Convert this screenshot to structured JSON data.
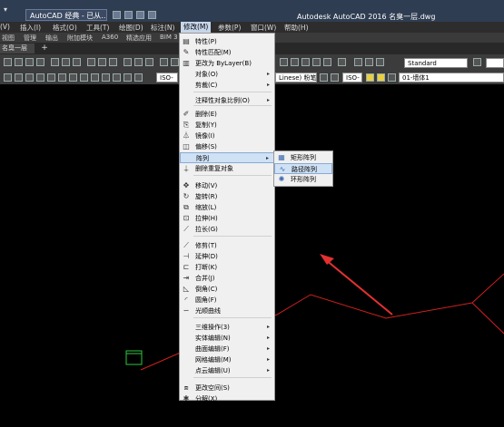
{
  "title_bar": {
    "left_glyph": "▾ ",
    "workspace": "AutoCAD 经典 - 已从...",
    "title": "Autodesk AutoCAD 2016    名臭一层.dwg"
  },
  "menu_bar": {
    "items": [
      "(V)",
      "插入(I)",
      "格式(O)",
      "工具(T)",
      "绘图(D)",
      "标注(N)",
      "修改(M)",
      "参数(P)",
      "窗口(W)",
      "帮助(H)"
    ]
  },
  "ribbon_tabs": [
    "视图",
    "管理",
    "输出",
    "附加模块",
    "A360",
    "精选应用",
    "BIM 3"
  ],
  "file_tab": {
    "label": "名臭一层",
    "plus": "+"
  },
  "toolbar": {
    "text_style": "Standard",
    "layer": "01-墙体1",
    "iso_left": "ISO-",
    "iso_right": "ISO-",
    "linetype": "Linese) 粉笔"
  },
  "modify_menu": {
    "items": [
      {
        "label": "特性(P)",
        "icon": "properties-icon",
        "glyph": "▤",
        "arrow": ""
      },
      {
        "label": "特性匹配(M)",
        "icon": "match-properties-icon",
        "glyph": "✎",
        "arrow": ""
      },
      {
        "label": "更改为 ByLayer(B)",
        "icon": "bylayer-icon",
        "glyph": "▥",
        "arrow": ""
      },
      {
        "label": "对象(O)",
        "icon": "",
        "glyph": "",
        "arrow": "▸"
      },
      {
        "label": "剪裁(C)",
        "icon": "",
        "glyph": "",
        "arrow": "▸"
      },
      {
        "label": "注释性对象比例(O)",
        "icon": "",
        "glyph": "",
        "arrow": "▸"
      },
      {
        "label": "删除(E)",
        "icon": "erase-icon",
        "glyph": "✐",
        "arrow": ""
      },
      {
        "label": "复制(Y)",
        "icon": "copy-icon",
        "glyph": "⎘",
        "arrow": ""
      },
      {
        "label": "镜像(I)",
        "icon": "mirror-icon",
        "glyph": "⏃",
        "arrow": ""
      },
      {
        "label": "偏移(S)",
        "icon": "offset-icon",
        "glyph": "◫",
        "arrow": ""
      },
      {
        "label": "阵列",
        "icon": "",
        "glyph": "",
        "arrow": "▸"
      },
      {
        "label": "删除重复对象",
        "icon": "delete-duplicates-icon",
        "glyph": "⍊",
        "arrow": ""
      },
      {
        "label": "移动(V)",
        "icon": "move-icon",
        "glyph": "✥",
        "arrow": ""
      },
      {
        "label": "旋转(R)",
        "icon": "rotate-icon",
        "glyph": "↻",
        "arrow": ""
      },
      {
        "label": "缩放(L)",
        "icon": "scale-icon",
        "glyph": "⧉",
        "arrow": ""
      },
      {
        "label": "拉伸(H)",
        "icon": "stretch-icon",
        "glyph": "⊡",
        "arrow": ""
      },
      {
        "label": "拉长(G)",
        "icon": "lengthen-icon",
        "glyph": "⟋",
        "arrow": ""
      },
      {
        "label": "修剪(T)",
        "icon": "trim-icon",
        "glyph": "⟋",
        "arrow": ""
      },
      {
        "label": "延伸(D)",
        "icon": "extend-icon",
        "glyph": "⊣",
        "arrow": ""
      },
      {
        "label": "打断(K)",
        "icon": "break-icon",
        "glyph": "⊏",
        "arrow": ""
      },
      {
        "label": "合并(J)",
        "icon": "join-icon",
        "glyph": "⇥",
        "arrow": ""
      },
      {
        "label": "倒角(C)",
        "icon": "chamfer-icon",
        "glyph": "◺",
        "arrow": ""
      },
      {
        "label": "圆角(F)",
        "icon": "fillet-icon",
        "glyph": "◜",
        "arrow": ""
      },
      {
        "label": "光顺曲线",
        "icon": "blend-curves-icon",
        "glyph": "∽",
        "arrow": ""
      },
      {
        "label": "三维操作(3)",
        "icon": "",
        "glyph": "",
        "arrow": "▸"
      },
      {
        "label": "实体编辑(N)",
        "icon": "",
        "glyph": "",
        "arrow": "▸"
      },
      {
        "label": "曲面编辑(F)",
        "icon": "",
        "glyph": "",
        "arrow": "▸"
      },
      {
        "label": "网格编辑(M)",
        "icon": "",
        "glyph": "",
        "arrow": "▸"
      },
      {
        "label": "点云编辑(U)",
        "icon": "",
        "glyph": "",
        "arrow": "▸"
      },
      {
        "label": "更改空间(S)",
        "icon": "change-space-icon",
        "glyph": "⧈",
        "arrow": ""
      },
      {
        "label": "分解(X)",
        "icon": "explode-icon",
        "glyph": "✱",
        "arrow": ""
      }
    ]
  },
  "array_submenu": {
    "items": [
      {
        "label": "矩形阵列",
        "icon": "rectangular-array-icon",
        "glyph": "▦"
      },
      {
        "label": "路径阵列",
        "icon": "path-array-icon",
        "glyph": "∿"
      },
      {
        "label": "环形阵列",
        "icon": "polar-array-icon",
        "glyph": "✺"
      }
    ]
  },
  "colors": {
    "menu_highlight": "#cfe1f5",
    "annotation_arrow": "#e53030",
    "drawing_line": "#d02020",
    "drawing_object": "#2ec840"
  }
}
